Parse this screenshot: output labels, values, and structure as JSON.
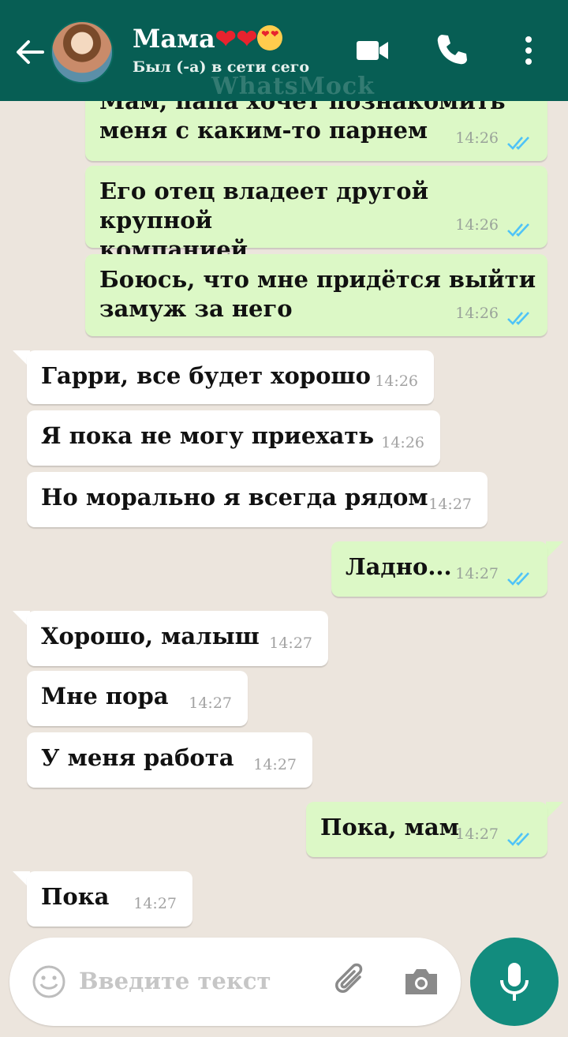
{
  "header": {
    "contact_name": "Мама",
    "status": "Был (-а) в сети сего",
    "watermark": "WhatsMock"
  },
  "messages": [
    {
      "dir": "out",
      "text_line1": "Мам, папа хочет познакомить",
      "text_line2": "меня с каким-то парнем",
      "time": "14:26"
    },
    {
      "dir": "out",
      "text_line1": "Его отец владеет другой крупной",
      "text_line2": "компанией",
      "time": "14:26"
    },
    {
      "dir": "out",
      "text_line1": "Боюсь, что мне придётся выйти",
      "text_line2": "замуж за него",
      "time": "14:26"
    },
    {
      "dir": "in",
      "text": "Гарри, все будет хорошо",
      "time": "14:26"
    },
    {
      "dir": "in",
      "text": "Я пока не могу приехать",
      "time": "14:26"
    },
    {
      "dir": "in",
      "text": "Но морально я всегда рядом",
      "time": "14:27"
    },
    {
      "dir": "out",
      "text": "Ладно...",
      "time": "14:27"
    },
    {
      "dir": "in",
      "text": "Хорошо, малыш",
      "time": "14:27"
    },
    {
      "dir": "in",
      "text": "Мне пора",
      "time": "14:27"
    },
    {
      "dir": "in",
      "text": "У меня работа",
      "time": "14:27"
    },
    {
      "dir": "out",
      "text": "Пока, мам",
      "time": "14:27"
    },
    {
      "dir": "in",
      "text": "Пока",
      "time": "14:27"
    }
  ],
  "input": {
    "placeholder": "Введите текст"
  },
  "colors": {
    "header": "#075e54",
    "outgoing": "#dcf8c6",
    "incoming": "#ffffff",
    "tick": "#4fc3f7",
    "mic": "#128c7e"
  }
}
